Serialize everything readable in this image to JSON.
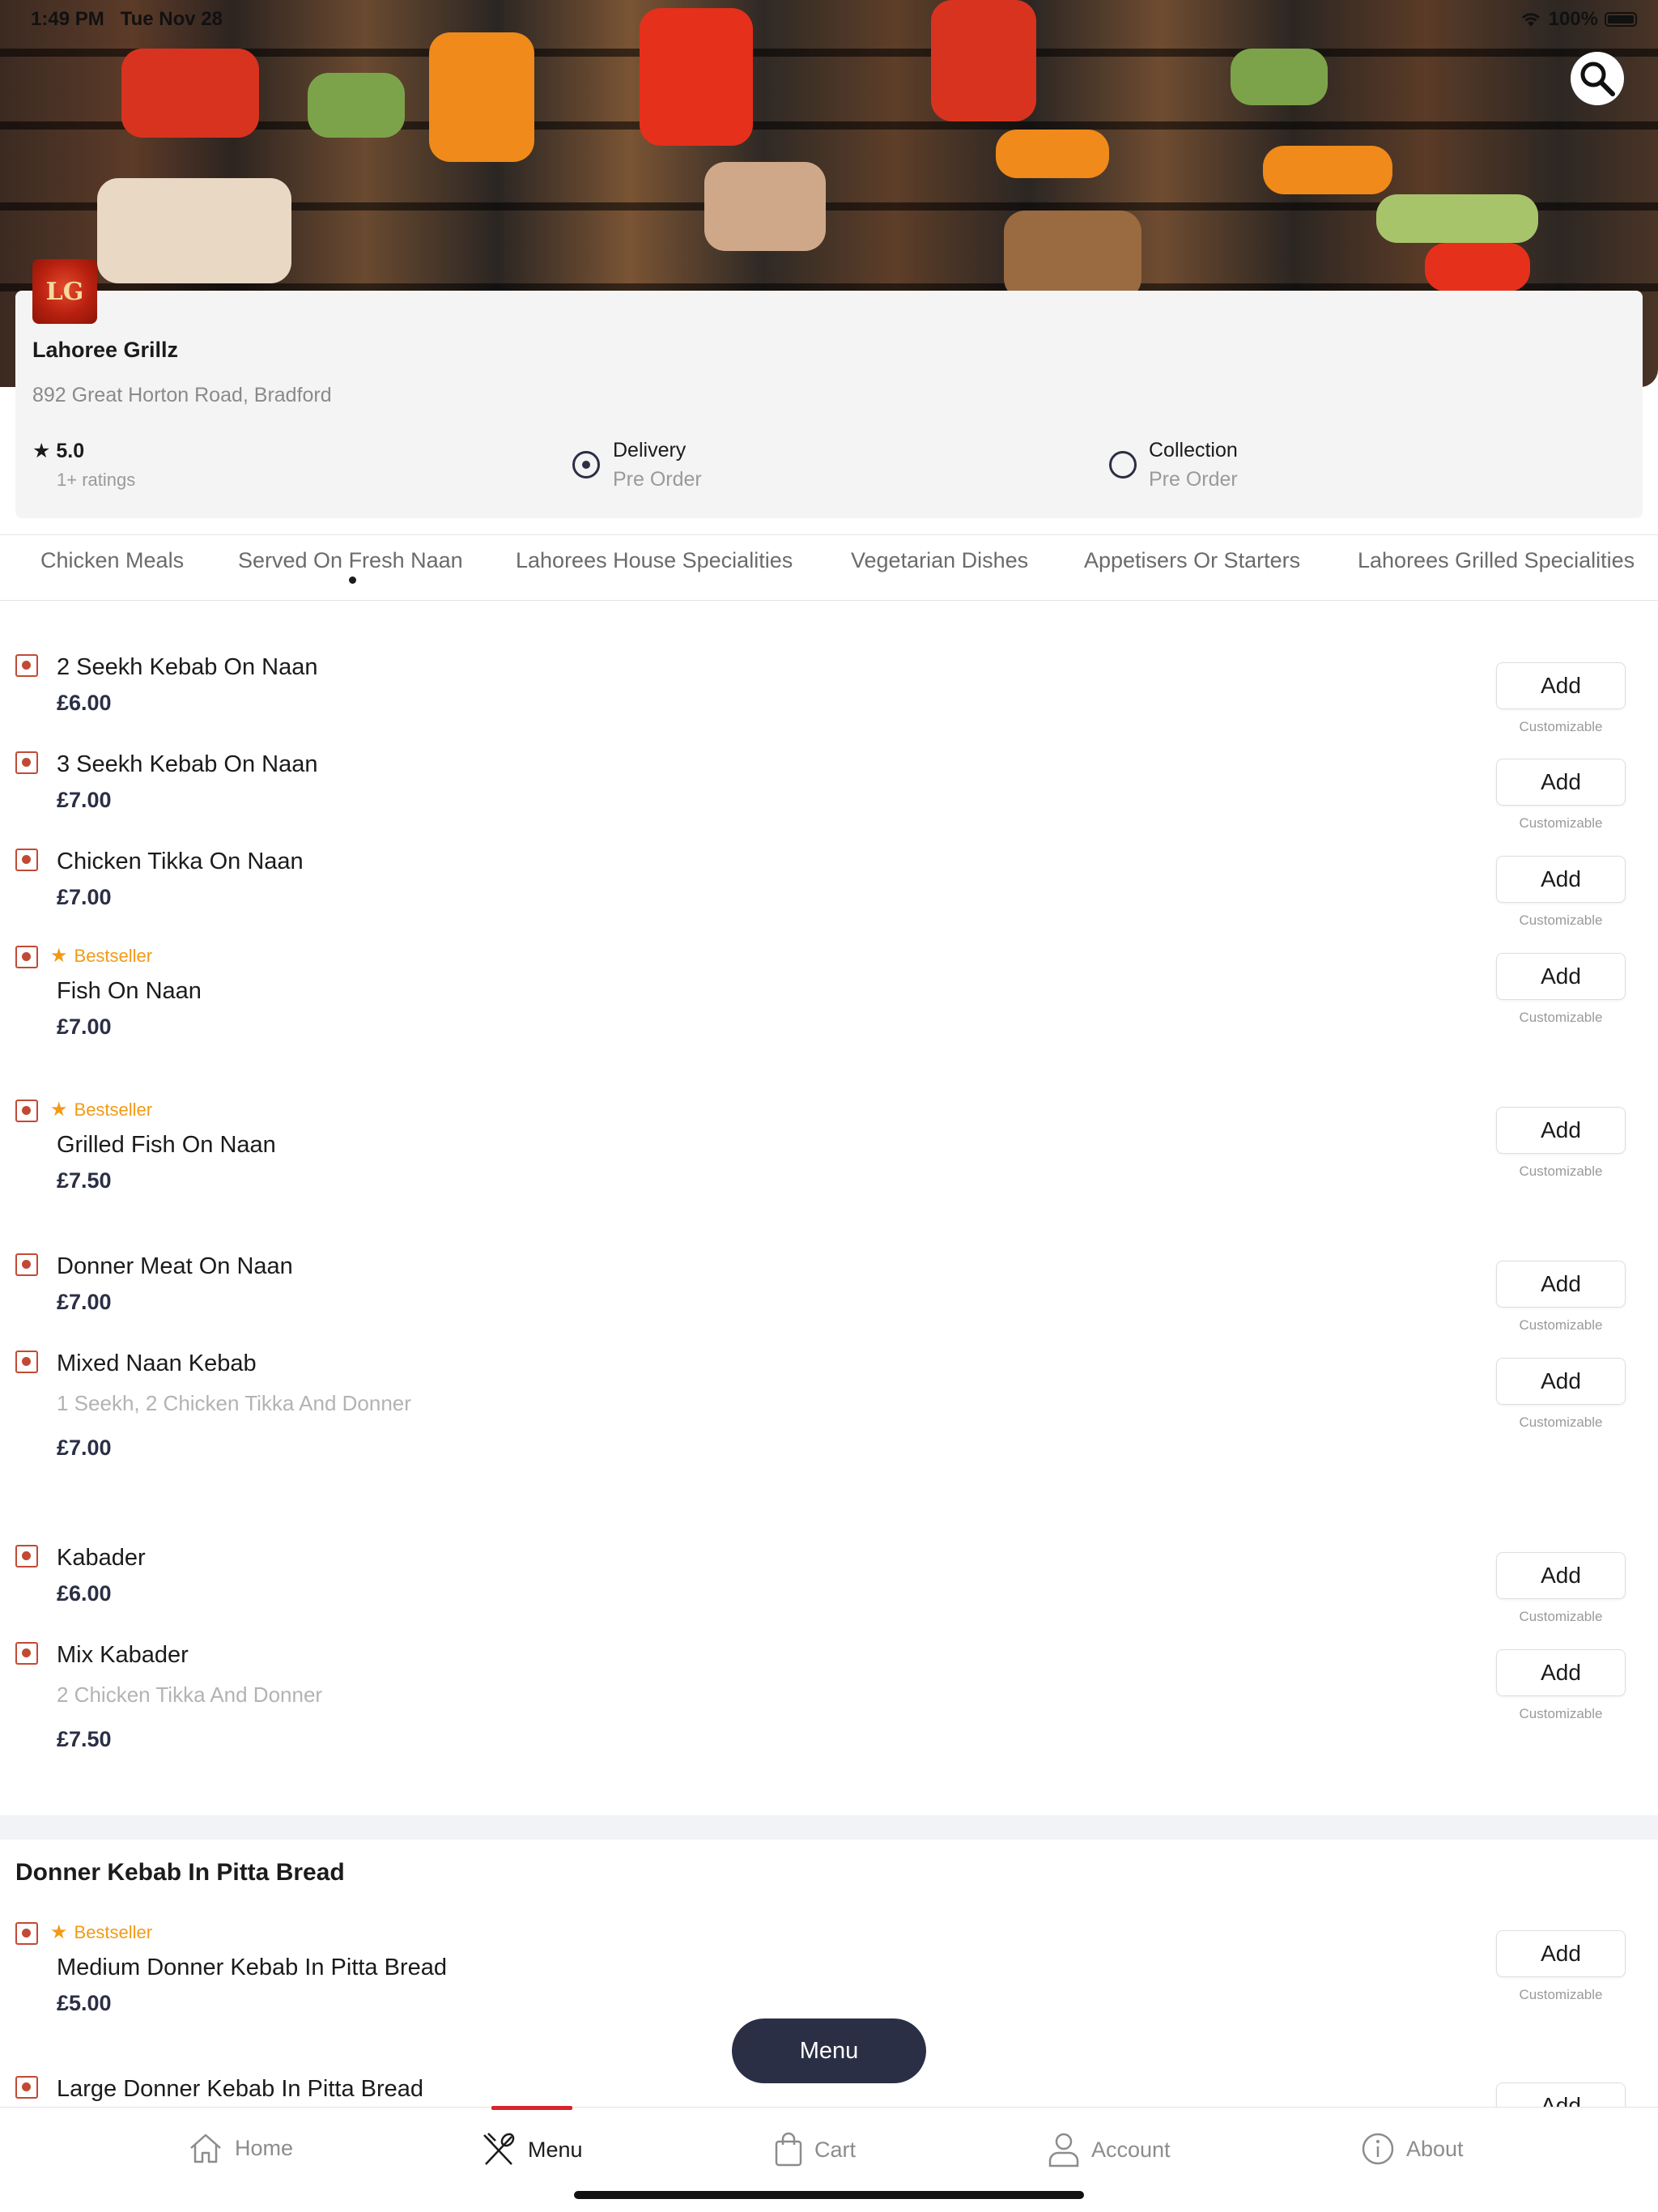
{
  "status_bar": {
    "time": "1:49 PM",
    "date": "Tue Nov 28",
    "battery": "100%"
  },
  "restaurant": {
    "name": "Lahoree Grillz",
    "address": "892 Great Horton Road, Bradford",
    "rating": "5.0",
    "ratings_count": "1+ ratings",
    "delivery_label": "Delivery",
    "delivery_sub": "Pre Order",
    "collection_label": "Collection",
    "collection_sub": "Pre Order",
    "selected_mode": "Delivery"
  },
  "tabs": [
    "Chicken Meals",
    "Served On Fresh Naan",
    "Lahorees House Specialities",
    "Vegetarian Dishes",
    "Appetisers Or Starters",
    "Lahorees Grilled Specialities"
  ],
  "active_tab": "Served On Fresh Naan",
  "labels": {
    "add": "Add",
    "customizable": "Customizable",
    "bestseller": "Bestseller",
    "menu_button": "Menu"
  },
  "items": [
    {
      "name": "2 Seekh Kebab On Naan",
      "price": "£6.00"
    },
    {
      "name": "3 Seekh Kebab On Naan",
      "price": "£7.00"
    },
    {
      "name": "Chicken Tikka On Naan",
      "price": "£7.00"
    },
    {
      "name": "Fish On Naan",
      "price": "£7.00",
      "bestseller": true
    },
    {
      "name": "Grilled Fish On Naan",
      "price": "£7.50",
      "bestseller": true
    },
    {
      "name": "Donner Meat On Naan",
      "price": "£7.00"
    },
    {
      "name": "Mixed Naan Kebab",
      "description": "1 Seekh, 2 Chicken Tikka And Donner",
      "price": "£7.00"
    },
    {
      "name": "Kabader",
      "price": "£6.00"
    },
    {
      "name": "Mix Kabader",
      "description": "2 Chicken Tikka And Donner",
      "price": "£7.50"
    }
  ],
  "section2": {
    "title": "Donner Kebab In Pitta Bread",
    "items": [
      {
        "name": "Medium Donner Kebab In Pitta Bread",
        "price": "£5.00",
        "bestseller": true
      },
      {
        "name": "Large Donner Kebab In Pitta Bread"
      }
    ]
  },
  "bottom_nav": [
    {
      "label": "Home",
      "icon": "home-icon"
    },
    {
      "label": "Menu",
      "icon": "cutlery-icon",
      "active": true
    },
    {
      "label": "Cart",
      "icon": "shopping-bag-icon"
    },
    {
      "label": "Account",
      "icon": "user-icon"
    },
    {
      "label": "About",
      "icon": "info-icon"
    }
  ],
  "colors": {
    "accent": "#d9232d",
    "navy": "#2b2f45",
    "bestseller": "#f29a16",
    "veg_marker": "#c24a34"
  }
}
